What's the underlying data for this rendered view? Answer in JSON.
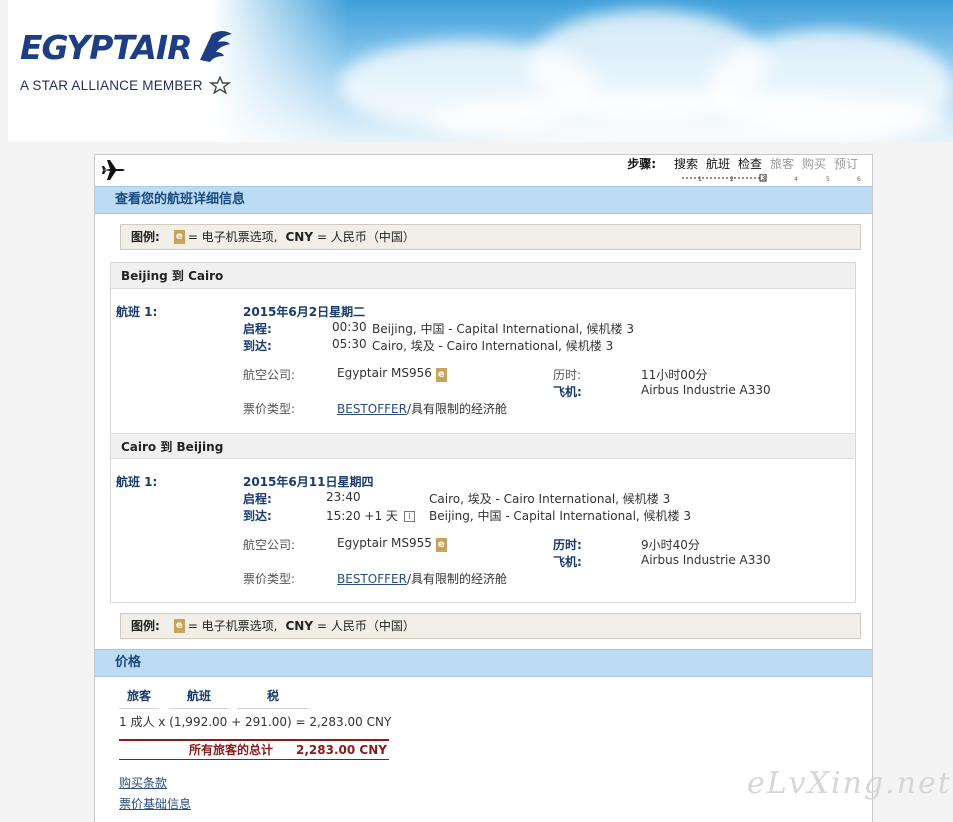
{
  "brand": {
    "logo_text": "EGYPTAIR",
    "tagline": "A STAR ALLIANCE MEMBER"
  },
  "colors": {
    "section_bar": "#bcdbf5",
    "heading_text": "#1a3b6d",
    "total_red": "#8b1a1a",
    "e_badge": "#c8a35a"
  },
  "steps": {
    "label": "步骤:",
    "items": [
      {
        "label": "搜索",
        "num": "1",
        "state": "done"
      },
      {
        "label": "航班",
        "num": "2",
        "state": "done"
      },
      {
        "label": "检查",
        "num": "3",
        "state": "current"
      },
      {
        "label": "旅客",
        "num": "4",
        "state": "todo"
      },
      {
        "label": "购买",
        "num": "5",
        "state": "todo"
      },
      {
        "label": "预订",
        "num": "6",
        "state": "todo"
      }
    ]
  },
  "details": {
    "title": "查看您的航班详细信息"
  },
  "legend": {
    "label": "图例:",
    "e": "e",
    "e_text": "= 电子机票选项,",
    "cny": "CNY",
    "cny_text": "= 人民币（中国）"
  },
  "routes": [
    {
      "header": "Beijing 到 Cairo",
      "flight_label": "航班 1:",
      "date": "2015年6月2日星期二",
      "depart_key": "启程:",
      "depart_time": "00:30",
      "depart_place": "Beijing, 中国 - Capital International, 候机楼 3",
      "arrive_key": "到达:",
      "arrive_time": "05:30",
      "arrive_place": "Cairo, 埃及 - Cairo International, 候机楼 3",
      "airline_key": "航空公司:",
      "airline": "Egyptair MS956",
      "duration_key": "历时:",
      "duration": "11小时00分",
      "aircraft_key": "飞机:",
      "aircraft": "Airbus Industrie A330",
      "fare_key": "票价类型:",
      "fare_link": "BESTOFFER",
      "fare_text": "/具有限制的经济舱"
    },
    {
      "header": "Cairo 到 Beijing",
      "flight_label": "航班 1:",
      "date": "2015年6月11日星期四",
      "depart_key": "启程:",
      "depart_time": "23:40",
      "depart_place": "Cairo, 埃及 - Cairo International, 候机楼 3",
      "arrive_key": "到达:",
      "arrive_time": "15:20 +1 天",
      "arrive_place": "Beijing, 中国 - Capital International, 候机楼 3",
      "airline_key": "航空公司:",
      "airline": "Egyptair MS955",
      "duration_key": "历时:",
      "duration": "9小时40分",
      "aircraft_key": "飞机:",
      "aircraft": "Airbus Industrie A330",
      "fare_key": "票价类型:",
      "fare_link": "BESTOFFER",
      "fare_text": "/具有限制的经济舱"
    }
  ],
  "price": {
    "title": "价格",
    "col_passenger": "旅客",
    "col_flight": "航班",
    "col_tax": "税",
    "row_text": "1 成人  x  (1,992.00  +  291.00)  =  2,283.00 CNY",
    "total_label": "所有旅客的总计",
    "total_value": "2,283.00 CNY"
  },
  "links": {
    "purchase_terms": "购买条款",
    "fare_basis": "票价基础信息"
  },
  "watermark": "eLvXing.net"
}
